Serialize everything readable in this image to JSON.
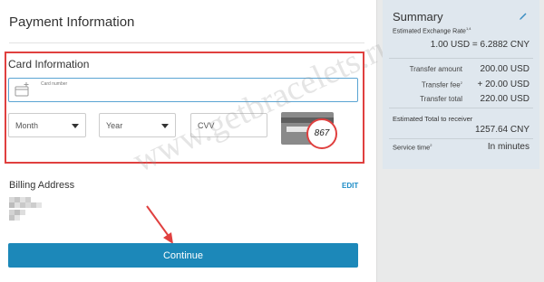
{
  "payment": {
    "title": "Payment Information",
    "card_section": "Card Information",
    "card_number_label": "Card number",
    "month": "Month",
    "year": "Year",
    "cvv": "CVV",
    "cvv_example": "867",
    "billing_address": "Billing Address",
    "edit": "EDIT",
    "continue": "Continue"
  },
  "summary": {
    "title": "Summary",
    "estimated_rate_label": "Estimated Exchange Rate",
    "estimated_rate_sup": "1,4",
    "rate_value": "1.00 USD = 6.2882 CNY",
    "transfer_amount_label": "Transfer amount",
    "transfer_amount_value": "200.00  USD",
    "transfer_fee_label": "Transfer fee",
    "transfer_fee_sup": "2",
    "transfer_fee_value": "+ 20.00  USD",
    "transfer_total_label": "Transfer total",
    "transfer_total_value": "220.00  USD",
    "total_receiver_label": "Estimated Total to receiver",
    "total_receiver_value": "1257.64 CNY",
    "service_time_label": "Service time",
    "service_time_sup": "2",
    "service_time_value": "In minutes"
  },
  "watermark": "www.getbracelets.ru",
  "colors": {
    "accent": "#1c88b9",
    "highlight": "#e0403f",
    "summary_bg": "#dfe7ee"
  },
  "icons": [
    "card-icon",
    "chevron-down-icon",
    "pencil-icon",
    "cvv-card-icon",
    "red-arrow-icon"
  ]
}
